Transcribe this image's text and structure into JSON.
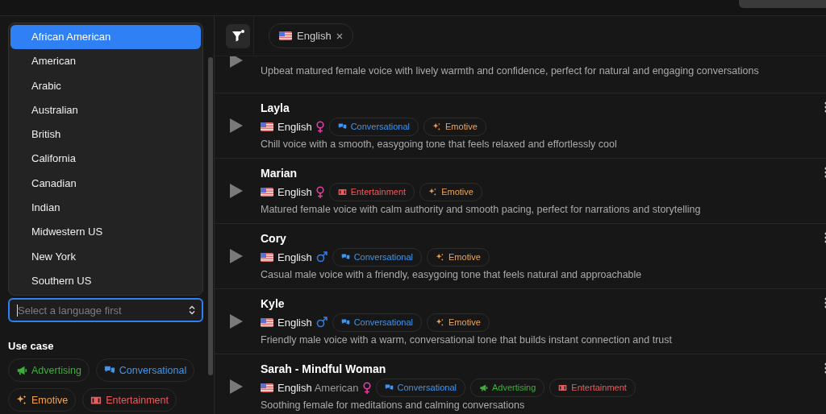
{
  "accent_dropdown": {
    "options": [
      {
        "label": "African American",
        "selected": true
      },
      {
        "label": "American",
        "selected": false
      },
      {
        "label": "Arabic",
        "selected": false
      },
      {
        "label": "Australian",
        "selected": false
      },
      {
        "label": "British",
        "selected": false
      },
      {
        "label": "California",
        "selected": false
      },
      {
        "label": "Canadian",
        "selected": false
      },
      {
        "label": "Indian",
        "selected": false
      },
      {
        "label": "Midwestern US",
        "selected": false
      },
      {
        "label": "New York",
        "selected": false
      },
      {
        "label": "Southern US",
        "selected": false
      }
    ],
    "placeholder": "Select a language first"
  },
  "use_case": {
    "title": "Use case",
    "chips": [
      {
        "label": "Advertising",
        "kind": "advertising"
      },
      {
        "label": "Conversational",
        "kind": "conversational"
      },
      {
        "label": "Emotive",
        "kind": "emotive"
      },
      {
        "label": "Entertainment",
        "kind": "entertainment"
      }
    ]
  },
  "filters": [
    {
      "label": "English"
    }
  ],
  "voices": [
    {
      "description": "Upbeat matured female voice with lively warmth and confidence, perfect for natural and engaging conversations"
    },
    {
      "name": "Layla",
      "language": "English",
      "female": true,
      "tags": [
        {
          "label": "Conversational",
          "kind": "conversational"
        },
        {
          "label": "Emotive",
          "kind": "emotive"
        }
      ],
      "description": "Chill voice with a smooth, easygoing tone that feels relaxed and effortlessly cool"
    },
    {
      "name": "Marian",
      "language": "English",
      "female": true,
      "tags": [
        {
          "label": "Entertainment",
          "kind": "entertainment"
        },
        {
          "label": "Emotive",
          "kind": "emotive"
        }
      ],
      "description": "Matured female voice with calm authority and smooth pacing, perfect for narrations and storytelling"
    },
    {
      "name": "Cory",
      "language": "English",
      "female": false,
      "tags": [
        {
          "label": "Conversational",
          "kind": "conversational"
        },
        {
          "label": "Emotive",
          "kind": "emotive"
        }
      ],
      "description": "Casual male voice with a friendly, easygoing tone that feels natural and approachable"
    },
    {
      "name": "Kyle",
      "language": "English",
      "female": false,
      "tags": [
        {
          "label": "Conversational",
          "kind": "conversational"
        },
        {
          "label": "Emotive",
          "kind": "emotive"
        }
      ],
      "description": "Friendly male voice with a warm, conversational tone that builds instant connection and trust"
    },
    {
      "name": "Sarah - Mindful Woman",
      "language": "English",
      "accent": "American",
      "female": true,
      "tags": [
        {
          "label": "Conversational",
          "kind": "conversational"
        },
        {
          "label": "Advertising",
          "kind": "advertising"
        },
        {
          "label": "Entertainment",
          "kind": "entertainment"
        }
      ],
      "description": "Soothing female for meditations and calming conversations"
    }
  ]
}
